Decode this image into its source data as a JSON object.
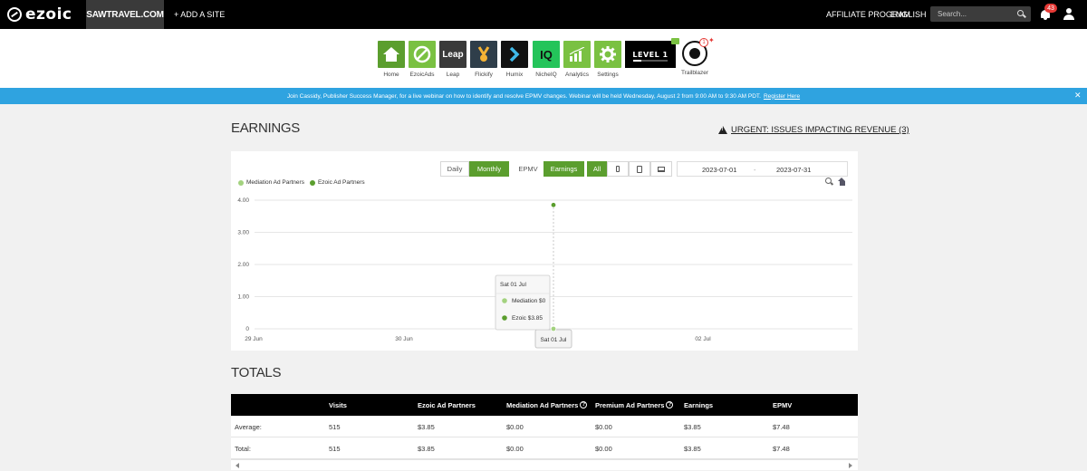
{
  "nav": {
    "logo": "ezoic",
    "site": "SAWTRAVEL.COM",
    "add_site": "+ ADD A SITE",
    "affiliate": "AFFILIATE PROGRAM",
    "language": "ENGLISH",
    "search_placeholder": "Search...",
    "notifications": "43"
  },
  "apps": [
    {
      "label": "Home",
      "color": "#5b9e2e",
      "icon": "home-icon"
    },
    {
      "label": "EzoicAds",
      "color": "#7ac142",
      "icon": "no-sign-icon"
    },
    {
      "label": "Leap",
      "color": "#3a3a3a",
      "icon": "leap-icon",
      "text": "Leap"
    },
    {
      "label": "Flickify",
      "color": "#2f3e4a",
      "icon": "flickify-icon"
    },
    {
      "label": "Humix",
      "color": "#111111",
      "icon": "humix-chevron-icon"
    },
    {
      "label": "NicheIQ",
      "color": "#24c45a",
      "icon": "nicheiq-icon",
      "text": "IQ"
    },
    {
      "label": "Analytics",
      "color": "#7ac142",
      "icon": "analytics-chart-icon"
    },
    {
      "label": "Settings",
      "color": "#7ac142",
      "icon": "gear-icon"
    }
  ],
  "level": "LEVEL 1",
  "trailblazer": {
    "label": "Trailblazer",
    "badge": "1"
  },
  "banner": {
    "text": "Join Cassidy, Publisher Success Manager, for a live webinar on how to identify and resolve EPMV changes. Webinar will be held Wednesday, August 2 from 9:00 AM to 9:30 AM PDT.",
    "link": "Register Here"
  },
  "earnings": {
    "title": "EARNINGS",
    "urgent": "URGENT: ISSUES IMPACTING REVENUE (3)",
    "toggles": {
      "daily": "Daily",
      "monthly": "Monthly",
      "epmv": "EPMV",
      "earnings": "Earnings",
      "all": "All"
    },
    "date_from": "2023-07-01",
    "date_sep": "-",
    "date_to": "2023-07-31",
    "tooltip": {
      "title": "Sat 01 Jul",
      "rows": [
        {
          "name": "Mediation",
          "value": "$0"
        },
        {
          "name": "Ezoic",
          "value": "$3.85"
        }
      ]
    },
    "crosshair_label": "Sat 01 Jul"
  },
  "chart_data": {
    "type": "scatter",
    "title": "",
    "xlabel": "",
    "ylabel": "",
    "x_ticks": [
      "29 Jun",
      "30 Jun",
      "01 Jul",
      "02 Jul"
    ],
    "y_ticks": [
      "0",
      "1.00",
      "2.00",
      "3.00",
      "4.00"
    ],
    "ylim": [
      0,
      4
    ],
    "series": [
      {
        "name": "Mediation Ad Partners",
        "color": "#a3d27f",
        "points": [
          {
            "x": "01 Jul",
            "y": 0
          }
        ]
      },
      {
        "name": "Ezoic Ad Partners",
        "color": "#5b9e2e",
        "points": [
          {
            "x": "01 Jul",
            "y": 3.85
          }
        ]
      }
    ],
    "grid": true,
    "legend": "top-left"
  },
  "totals": {
    "title": "TOTALS",
    "columns": [
      "",
      "Visits",
      "Ezoic Ad Partners",
      "Mediation Ad Partners",
      "Premium Ad Partners",
      "Earnings",
      "EPMV"
    ],
    "rows": [
      [
        "Average:",
        "515",
        "$3.85",
        "$0.00",
        "$0.00",
        "$3.85",
        "$7.48"
      ],
      [
        "Total:",
        "515",
        "$3.85",
        "$0.00",
        "$0.00",
        "$3.85",
        "$7.48"
      ]
    ]
  }
}
